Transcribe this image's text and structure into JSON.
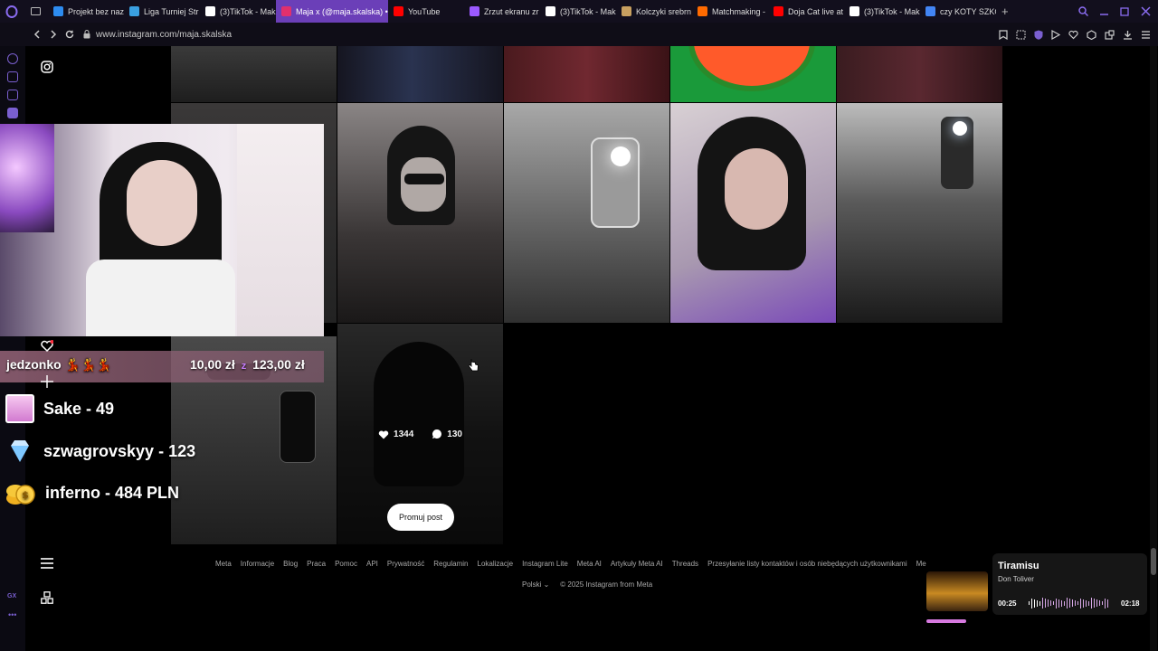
{
  "browser": {
    "tabs": [
      {
        "label": "Projekt bez naz",
        "color": "#2d8cf0",
        "active": false
      },
      {
        "label": "Liga Turniej Str",
        "color": "#3aa0e0",
        "active": false
      },
      {
        "label": "(3)TikTok - Mak",
        "color": "#ffffff",
        "active": false
      },
      {
        "label": "Maja x (@maja.skalska) •",
        "color": "#e1306c",
        "active": true
      },
      {
        "label": "YouTube",
        "color": "#ff0000",
        "active": false
      },
      {
        "label": "Zrzut ekranu zr",
        "color": "#9b59ff",
        "active": false
      },
      {
        "label": "(3)TikTok - Mak",
        "color": "#ffffff",
        "active": false
      },
      {
        "label": "Kolczyki srebrn",
        "color": "#c8a060",
        "active": false
      },
      {
        "label": "Matchmaking -",
        "color": "#ff6a00",
        "active": false
      },
      {
        "label": "Doja Cat live at",
        "color": "#ff0000",
        "active": false
      },
      {
        "label": "(3)TikTok - Mak",
        "color": "#ffffff",
        "active": false
      },
      {
        "label": "czy KOTY SZKO",
        "color": "#4285f4",
        "active": false
      }
    ],
    "url": "www.instagram.com/maja.skalska"
  },
  "post_overlay": {
    "likes": "1344",
    "comments": "130"
  },
  "promote_button": "Promuj post",
  "stream": {
    "donor": "jedzonko 💃💃💃",
    "donation": "10,00 zł",
    "donation_sep": "z",
    "donation_goal": "123,00 zł",
    "leaderboard": [
      {
        "text": "Sake - 49",
        "icon": "gift-icon"
      },
      {
        "text": "szwagrovskyy - 123",
        "icon": "diamond-icon"
      },
      {
        "text": "inferno - 484 PLN",
        "icon": "coins-icon"
      }
    ]
  },
  "footer": {
    "links": [
      "Meta",
      "Informacje",
      "Blog",
      "Praca",
      "Pomoc",
      "API",
      "Prywatność",
      "Regulamin",
      "Lokalizacje",
      "Instagram Lite",
      "Meta AI",
      "Artykuły Meta AI",
      "Threads",
      "Przesyłanie listy kontaktów i osób niebędących użytkownikami",
      "Me"
    ],
    "language": "Polski",
    "copyright": "© 2025 Instagram from Meta"
  },
  "music": {
    "title": "Tiramisu",
    "artist": "Don Toliver",
    "elapsed": "00:25",
    "total": "02:18",
    "progress": 0.18
  },
  "colors": {
    "accent": "#6b3fb8",
    "donation_highlight": "#c77dff"
  }
}
